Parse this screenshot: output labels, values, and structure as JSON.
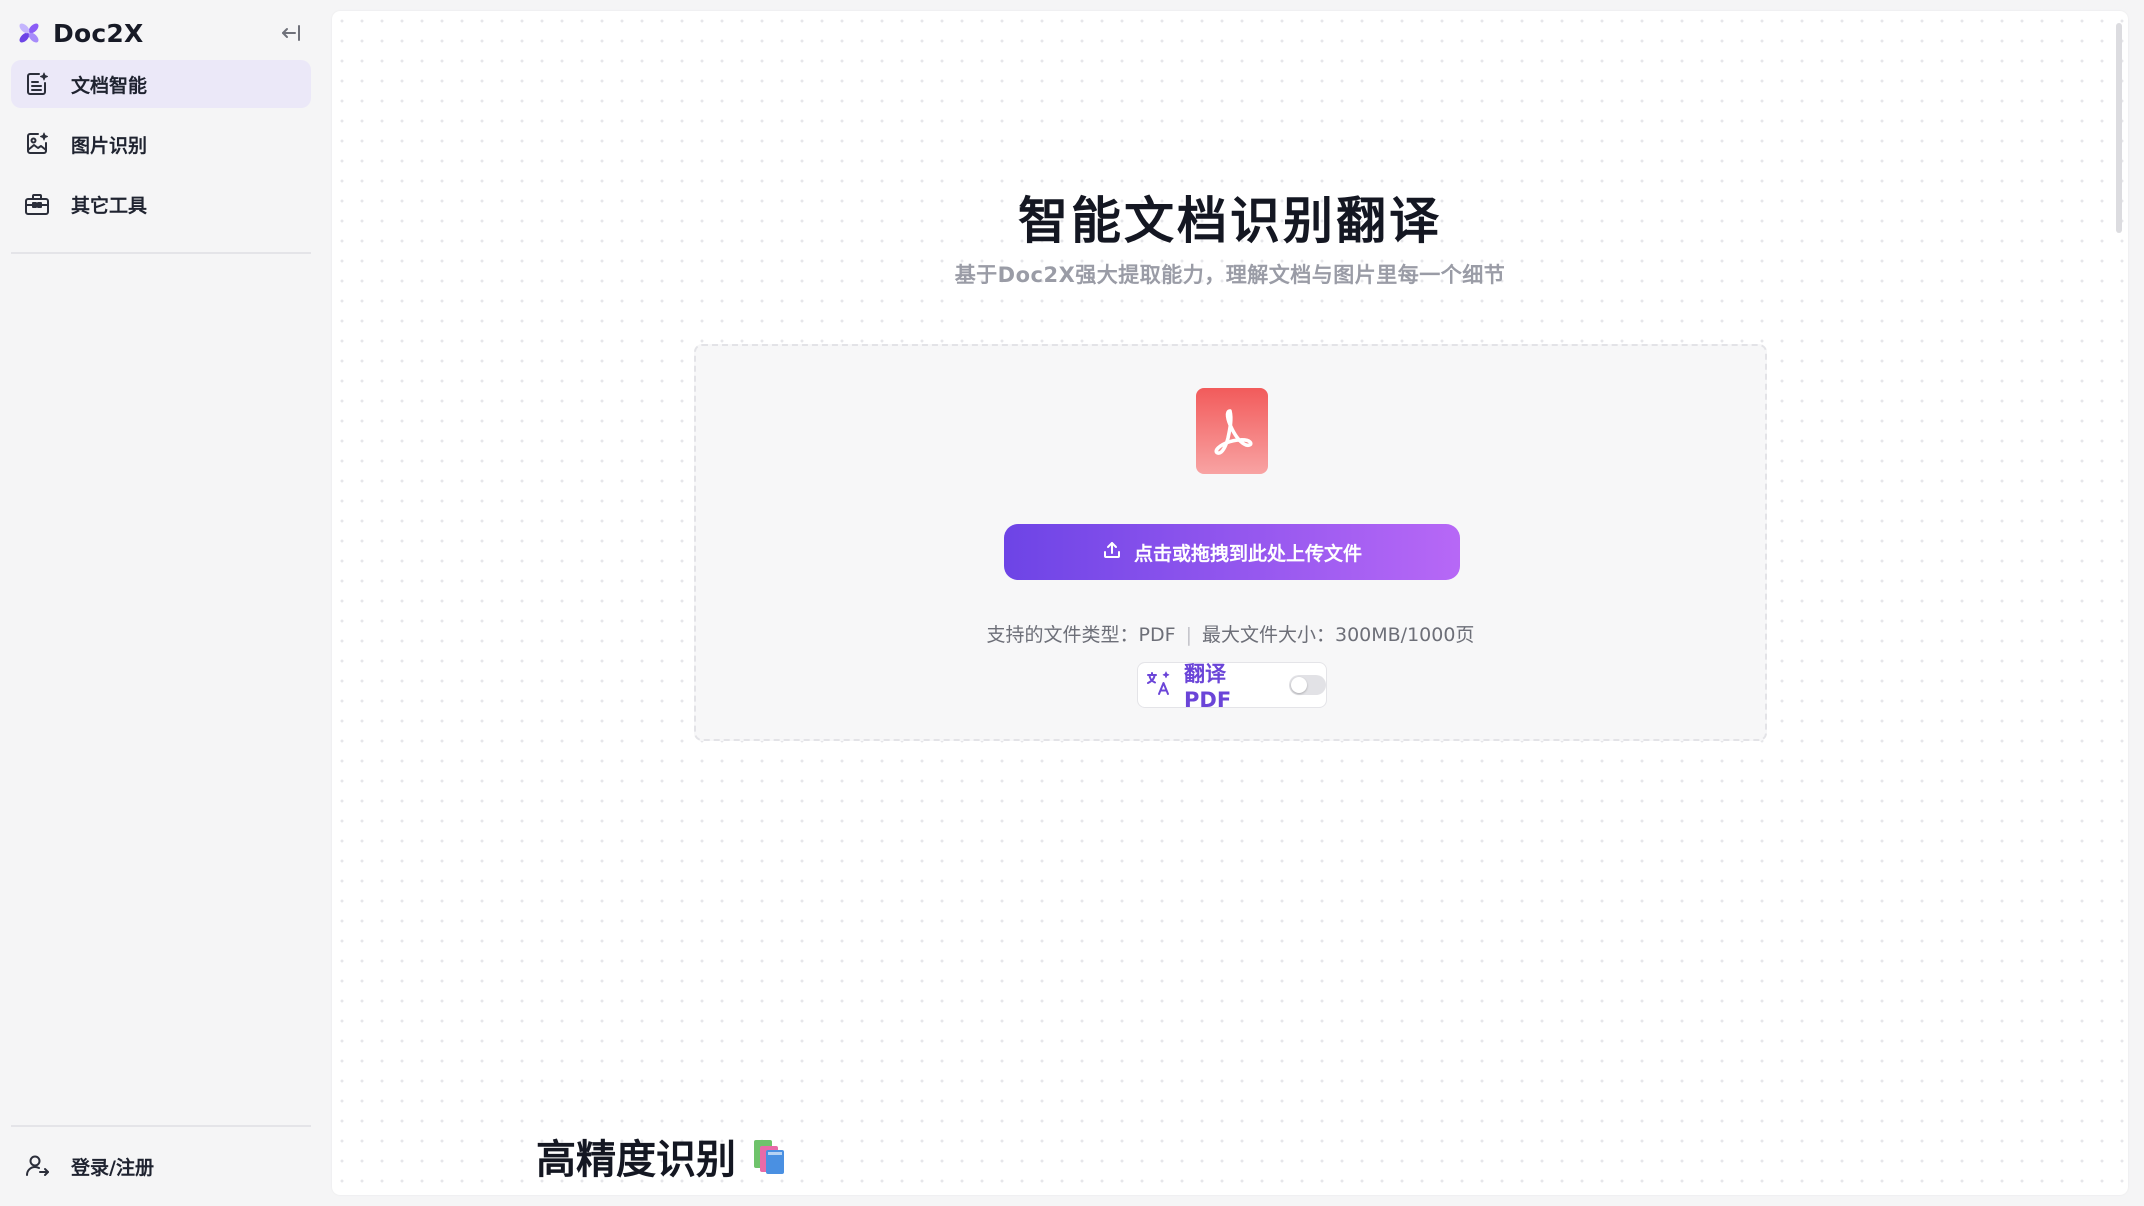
{
  "app": {
    "name": "Doc2X",
    "accent_color": "#6d44e6",
    "accent_gradient_end": "#b768f6"
  },
  "sidebar": {
    "collapse_icon": "collapse-left-icon",
    "items": [
      {
        "label": "文档智能",
        "icon": "document-ai-icon",
        "active": true
      },
      {
        "label": "图片识别",
        "icon": "image-recognition-icon",
        "active": false
      },
      {
        "label": "其它工具",
        "icon": "toolbox-icon",
        "active": false
      }
    ],
    "login_label": "登录/注册",
    "login_icon": "user-login-icon"
  },
  "main": {
    "title": "智能文档识别翻译",
    "subtitle": "基于Doc2X强大提取能力，理解文档与图片里每一个细节",
    "upload": {
      "file_icon": "pdf-file-icon",
      "button_label": "点击或拖拽到此处上传文件",
      "button_icon": "upload-icon",
      "supported_types": "支持的文件类型：PDF",
      "max_size": "最大文件大小：300MB/1000页"
    },
    "translate": {
      "icon": "translate-icon",
      "label": "翻译 PDF",
      "enabled": false
    },
    "section_title": "高精度识别",
    "section_icon": "books-icon"
  }
}
